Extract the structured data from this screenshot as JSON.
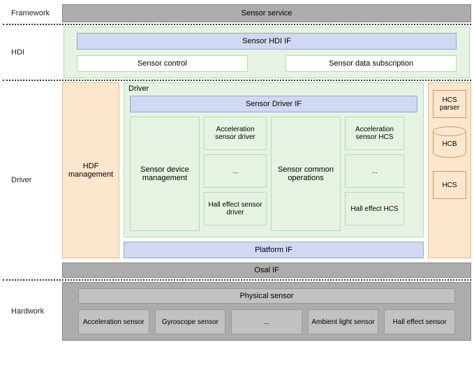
{
  "framework": {
    "label": "Framework",
    "box": "Sensor service"
  },
  "hdi": {
    "label": "HDI",
    "top": "Sensor HDI IF",
    "left": "Sensor control",
    "right": "Sensor data subscription"
  },
  "driver": {
    "label": "Driver",
    "hdf": "HDF management",
    "green_title": "Driver",
    "sdif": "Sensor Driver IF",
    "sdm": "Sensor device management",
    "drivers": {
      "a": "Acceleration sensor driver",
      "b": "...",
      "c": "Hall effect sensor driver"
    },
    "sco": "Sensor common operations",
    "hcs_col": {
      "a": "Acceleration sensor HCS",
      "b": "...",
      "c": "Hall effect HCS"
    },
    "plat": "Platform IF",
    "side": {
      "parser": "HCS parser",
      "hcb": "HCB",
      "hcs": "HCS"
    },
    "osal": "Osal IF"
  },
  "hardwork": {
    "label": "Hardwork",
    "top": "Physical sensor",
    "items": {
      "a": "Acceleration sensor",
      "b": "Gyroscope sensor",
      "c": "...",
      "d": "Ambient light sensor",
      "e": "Hall effect sensor"
    }
  }
}
